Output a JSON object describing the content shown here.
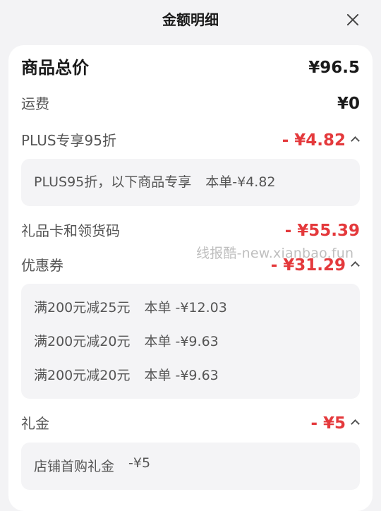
{
  "header": {
    "title": "金额明细"
  },
  "rows": {
    "total": {
      "label": "商品总价",
      "value": "¥96.5"
    },
    "shipping": {
      "label": "运费",
      "value": "¥0"
    },
    "plus": {
      "label": "PLUS专享95折",
      "value": "- ¥4.82",
      "detail": {
        "desc": "PLUS95折，以下商品专享",
        "amount": "本单-¥4.82"
      }
    },
    "giftcard": {
      "label": "礼品卡和领货码",
      "value": "- ¥55.39"
    },
    "coupon": {
      "label": "优惠券",
      "value": "- ¥31.29",
      "items": [
        {
          "desc": "满200元减25元",
          "amount": "本单 -¥12.03"
        },
        {
          "desc": "满200元减20元",
          "amount": "本单 -¥9.63"
        },
        {
          "desc": "满200元减20元",
          "amount": "本单 -¥9.63"
        }
      ]
    },
    "cashgift": {
      "label": "礼金",
      "value": "- ¥5",
      "detail": {
        "desc": "店铺首购礼金",
        "amount": "-¥5"
      }
    }
  },
  "watermark": "线报酷-new.xianbao.fun",
  "colors": {
    "accent_red": "#e4393c",
    "background": "#f3f3f5",
    "card": "#ffffff",
    "detail_box": "#f4f4f6"
  }
}
